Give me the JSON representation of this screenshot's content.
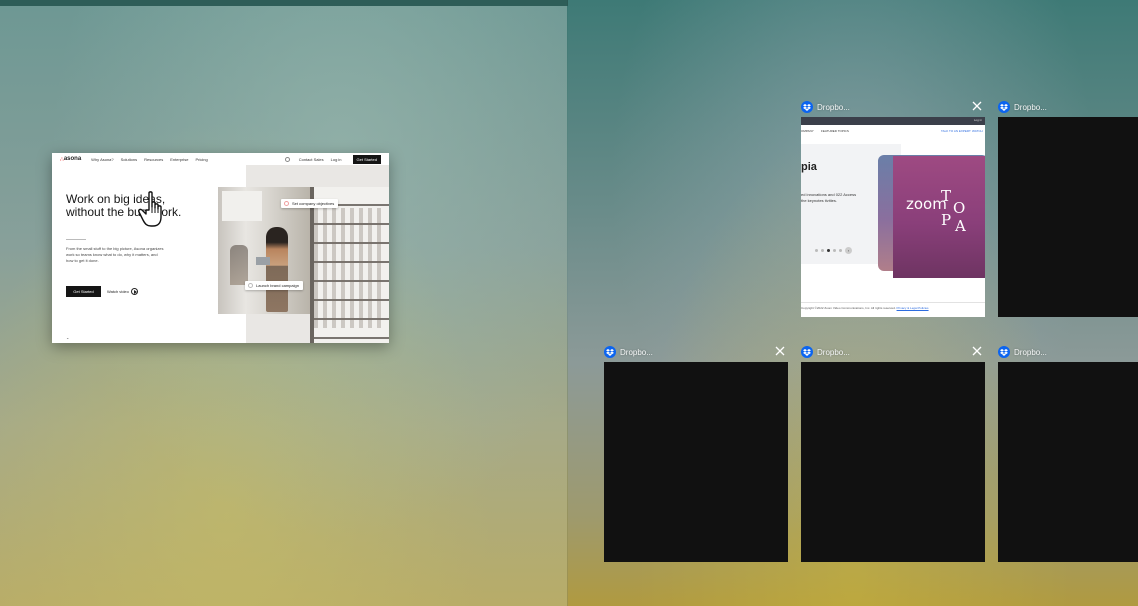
{
  "background": {
    "accent_teal": "#3f7d79",
    "accent_gold": "#a89a52"
  },
  "asona": {
    "logo": "asona",
    "nav_links": [
      "Why Asona?",
      "Solutions",
      "Resources",
      "Enterprise",
      "Pricing"
    ],
    "contact": "Contact Sales",
    "login": "Log in",
    "get_started_nav": "Get Started",
    "headline_1": "Work on big ideas,",
    "headline_2": "without the busywork.",
    "paragraph": "From the small stuff to the big picture, Asona organizes work so teams know what to do, why it matters, and how to get it done.",
    "cta": "Get Started",
    "watch": "Watch video",
    "footnote": "⌄",
    "tag_1": "Set company objectives",
    "tag_2": "Launch brand campaign"
  },
  "windows": [
    {
      "title": "Dropbo..."
    },
    {
      "title": "Dropbo..."
    },
    {
      "title": "Dropbo..."
    },
    {
      "title": "Dropbo..."
    },
    {
      "title": "Dropbo..."
    }
  ],
  "zoom_page": {
    "top_bar": "Log in",
    "nav_left_1": "OMPANY",
    "nav_left_2": "FEATURED TOPICS",
    "nav_right_1": "TALK TO AN EXPERT",
    "nav_right_2": "WATCH",
    "heading": "pia",
    "paragraph": "ed innovations and 022 Access the keynotes tivities.",
    "card_word": "zoom",
    "card_letters": [
      "T",
      "O",
      "P",
      "A"
    ],
    "footer_text": "Copyright ©2022 Zoom Video Communications, Inc. All rights reserved.",
    "footer_link": "Privacy & Legal Policies"
  }
}
